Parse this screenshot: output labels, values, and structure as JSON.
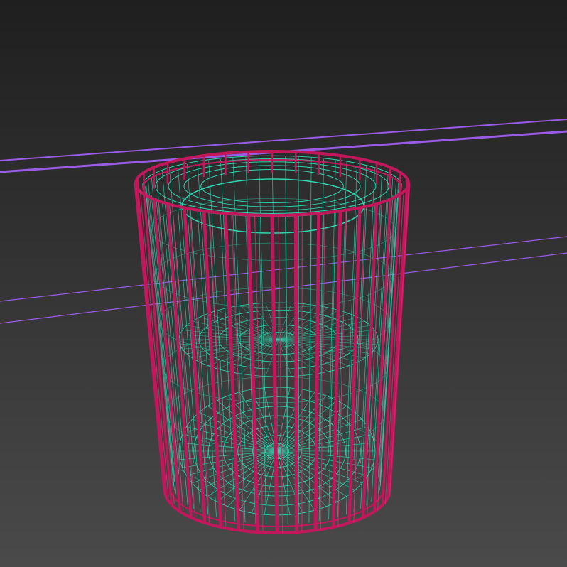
{
  "viewport": {
    "background_top": "#1f1f1f",
    "background_bottom": "#4a4a4a"
  },
  "objects": {
    "guide_lines": {
      "color": "#9a5ce6",
      "icon": "line-guide"
    },
    "outer_shell": {
      "color": "#c2185b",
      "highlight": "#e0246e",
      "icon": "cylinder-wireframe"
    },
    "inner_mesh": {
      "color": "#2fd6b0",
      "icon": "mesh-wireframe"
    }
  }
}
